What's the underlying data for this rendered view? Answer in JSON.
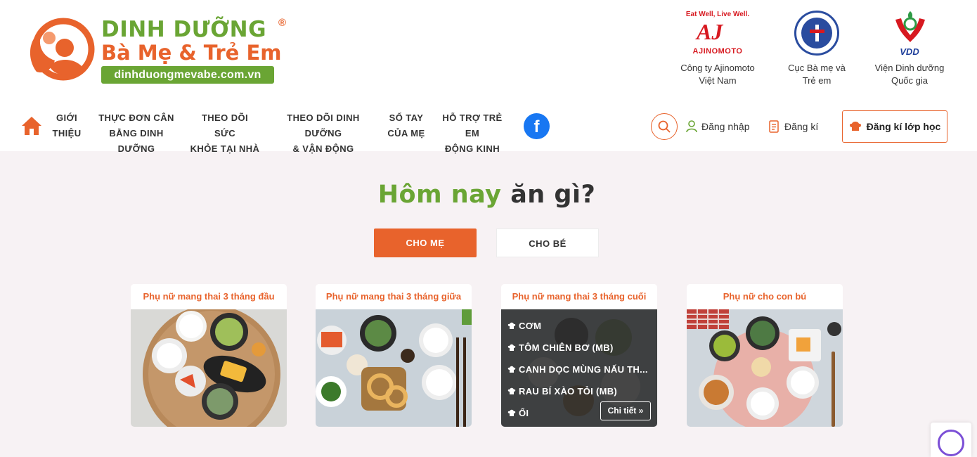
{
  "brand": {
    "line1": "DINH DƯỠNG",
    "registered": "®",
    "line2": "Bà Mẹ & Trẻ Em",
    "url": "dinhduongmevabe.com.vn"
  },
  "partners": [
    {
      "name": "Công ty Ajinomoto\nViệt Nam",
      "logo_top": "Eat Well, Live Well.",
      "logo_mark": "AJ",
      "logo_bottom": "AJINOMOTO"
    },
    {
      "name": "Cục Bà mẹ và\nTrẻ em"
    },
    {
      "name": "Viện Dinh dưỡng\nQuốc gia",
      "logo_text": "VDD"
    }
  ],
  "nav": {
    "items": [
      "GIỚI\nTHIỆU",
      "THỰC ĐƠN CÂN\nBẰNG DINH DƯỠNG",
      "THEO DÕI SỨC\nKHỎE TẠI NHÀ",
      "THEO DÕI DINH DƯỠNG\n& VẬN ĐỘNG",
      "SỔ TAY\nCỦA MẸ",
      "HỖ TRỢ TRẺ EM\nĐỘNG KINH"
    ],
    "facebook": "f",
    "login": "Đăng nhập",
    "register": "Đăng kí",
    "register_class": "Đăng kí lớp học"
  },
  "main": {
    "title_green": "Hôm nay",
    "title_dark": "ăn gì?",
    "tabs": [
      "CHO MẸ",
      "CHO BÉ"
    ],
    "active_tab": "CHO MẸ",
    "cards": [
      {
        "title": "Phụ nữ mang thai 3 tháng đầu"
      },
      {
        "title": "Phụ nữ mang thai 3 tháng giữa"
      },
      {
        "title": "Phụ nữ mang thai 3 tháng cuối",
        "dishes": [
          "CƠM",
          "TÔM CHIÊN BƠ (MB)",
          "CANH DỌC MÙNG NẤU TH...",
          "RAU BÍ XÀO TỎI (MB)",
          "ỔI"
        ],
        "detail": "Chi tiết"
      },
      {
        "title": "Phụ nữ cho con bú"
      }
    ]
  },
  "colors": {
    "accent_orange": "#e8632c",
    "brand_green": "#6aa534",
    "facebook_blue": "#1877f2"
  }
}
